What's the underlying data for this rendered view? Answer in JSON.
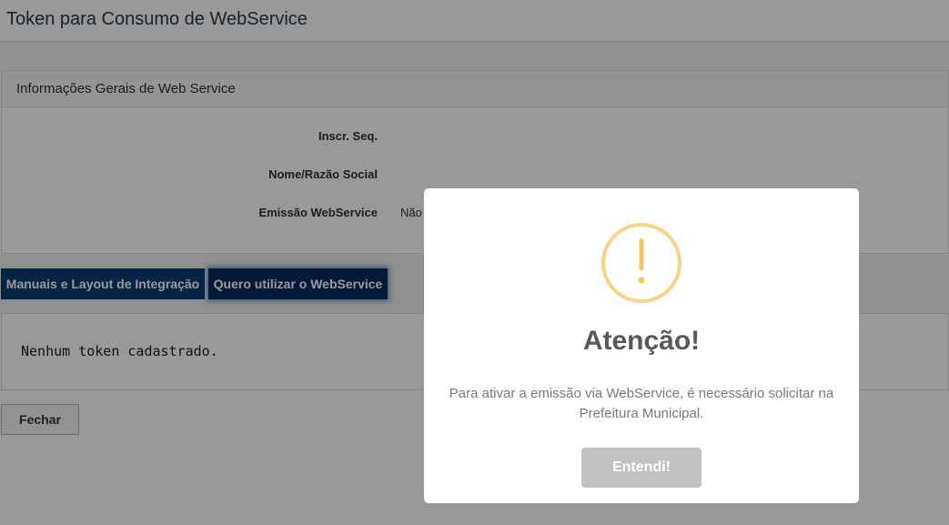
{
  "header": {
    "title": "Token para Consumo de WebService"
  },
  "info_panel": {
    "heading": "Informações Gerais de Web Service",
    "fields": [
      {
        "label": "Inscr. Seq.",
        "value": ""
      },
      {
        "label": "Nome/Razão Social",
        "value": ""
      },
      {
        "label": "Emissão WebService",
        "value": "Não"
      }
    ]
  },
  "tabs": {
    "manuals_label": "Manuais e Layout de Integração",
    "use_label": "Quero utilizar o WebService"
  },
  "token_panel": {
    "empty_text": "Nenhum token cadastrado."
  },
  "footer": {
    "close_label": "Fechar"
  },
  "modal": {
    "icon": "exclamation-circle-icon",
    "title": "Atenção!",
    "message": "Para ativar a emissão via WebService, é necessário solicitar na Prefeitura Municipal.",
    "confirm_label": "Entendi!"
  },
  "colors": {
    "primary_dark": "#0a3d74",
    "active_dark": "#012a60",
    "warning": "#f8d486",
    "confirm_button": "#c1c1c1"
  }
}
